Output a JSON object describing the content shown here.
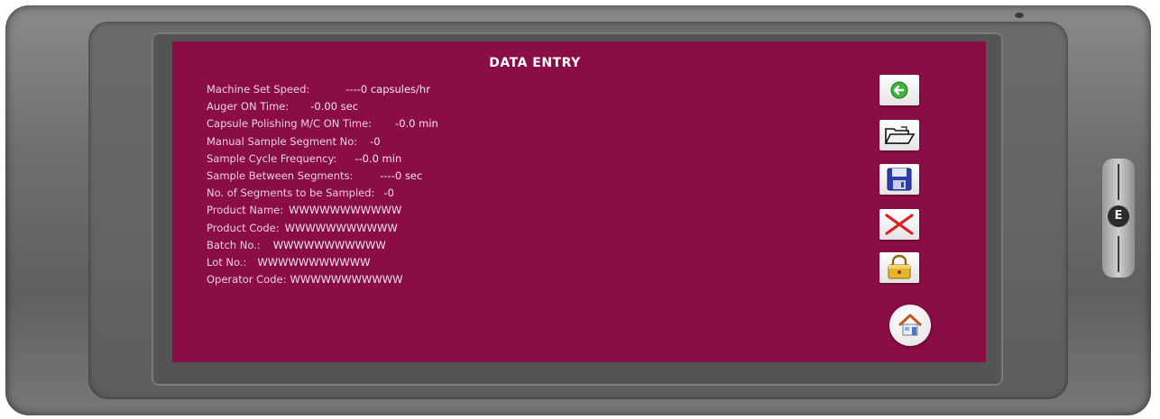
{
  "screen": {
    "title": "DATA ENTRY",
    "fields": [
      {
        "label": "Machine Set Speed:",
        "value": "----0   capsules/hr"
      },
      {
        "label": "Auger ON Time:",
        "value": "-0.00  sec"
      },
      {
        "label": "Capsule Polishing M/C ON Time:",
        "value": "-0.0  min"
      },
      {
        "label": "Manual Sample Segment No:",
        "value": "-0"
      },
      {
        "label": "Sample Cycle Frequency:",
        "value": "--0.0  min"
      },
      {
        "label": "Sample Between Segments:",
        "value": "----0  sec"
      },
      {
        "label": "No. of Segments to be Sampled:",
        "value": "-0"
      },
      {
        "label": "Product Name:",
        "value": "WWWWWWWWWWW"
      },
      {
        "label": "Product Code:",
        "value": "WWWWWWWWWWW"
      },
      {
        "label": "Batch No.:",
        "value": "WWWWWWWWWWW"
      },
      {
        "label": "Lot No.:",
        "value": "WWWWWWWWWWW"
      },
      {
        "label": "Operator Code:",
        "value": "WWWWWWWWWWW"
      }
    ]
  },
  "toolbar": {
    "buttons": [
      {
        "icon": "back-arrow-icon"
      },
      {
        "icon": "open-folder-icon"
      },
      {
        "icon": "save-disk-icon"
      },
      {
        "icon": "cancel-x-icon"
      },
      {
        "icon": "lock-icon"
      },
      {
        "icon": "home-icon"
      }
    ]
  },
  "device": {
    "brand_mark": "E"
  },
  "colors": {
    "screen_bg": "#8a0d45",
    "text": "#e8d3dc",
    "title": "#ffffff",
    "back_green": "#3cb43c",
    "cancel_red": "#e02020",
    "save_blue": "#2a3fa8"
  }
}
